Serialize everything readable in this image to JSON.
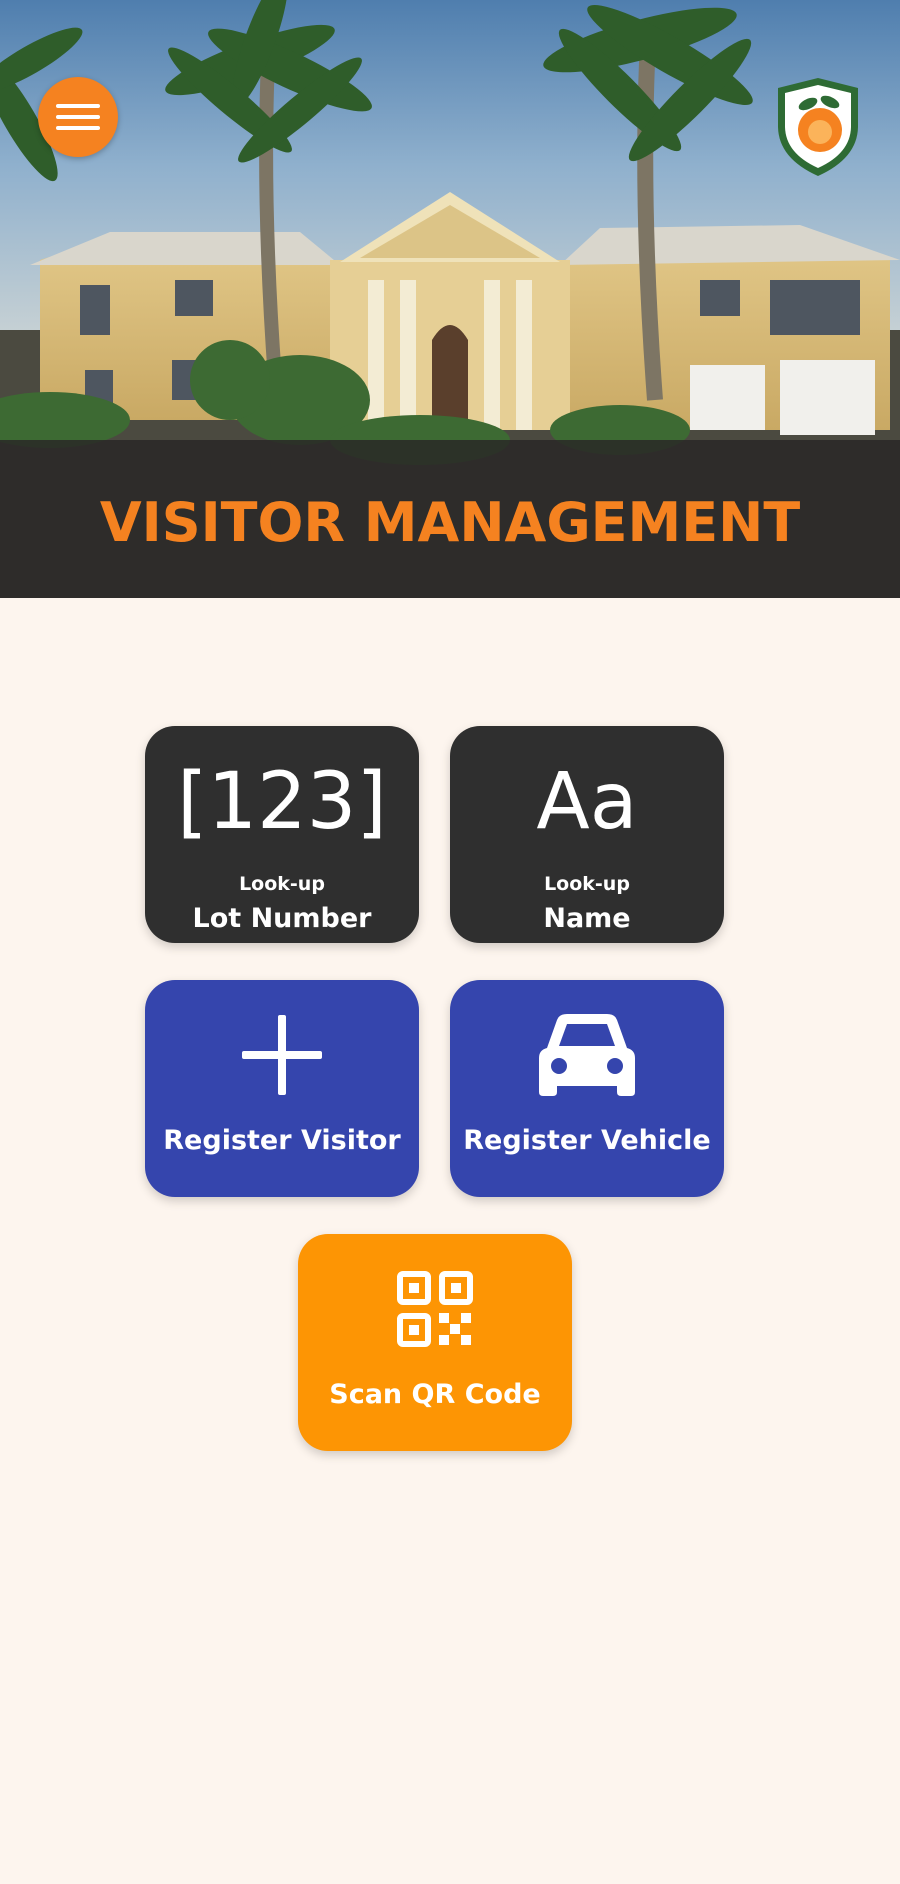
{
  "header": {
    "title": "VISITOR MANAGEMENT",
    "menu_icon": "hamburger-menu-icon",
    "logo_icon": "shield-logo-icon"
  },
  "actions": {
    "lot_lookup": {
      "glyph": "[123]",
      "sublabel": "Look-up",
      "label": "Lot Number"
    },
    "name_lookup": {
      "glyph": "Aa",
      "sublabel": "Look-up",
      "label": "Name"
    },
    "register_visitor": {
      "icon": "plus-icon",
      "label": "Register Visitor"
    },
    "register_vehicle": {
      "icon": "car-icon",
      "label": "Register Vehicle"
    },
    "scan_qr": {
      "icon": "qr-code-icon",
      "label": "Scan QR Code"
    }
  },
  "colors": {
    "accent_orange": "#f58220",
    "tile_dark": "#2f2f2f",
    "tile_blue": "#3545ad",
    "tile_orange": "#fd9504",
    "background": "#fdf5ee"
  }
}
